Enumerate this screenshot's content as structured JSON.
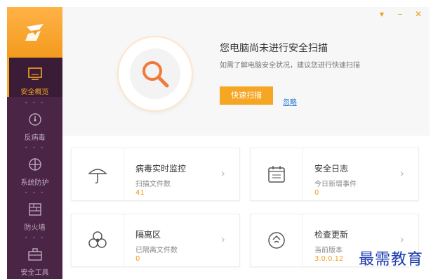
{
  "sidebar": {
    "items": [
      {
        "label": "安全概览",
        "icon": "monitor-icon"
      },
      {
        "label": "反病毒",
        "icon": "gauge-icon"
      },
      {
        "label": "系统防护",
        "icon": "shield-icon"
      },
      {
        "label": "防火墙",
        "icon": "firewall-icon"
      },
      {
        "label": "安全工具",
        "icon": "toolbox-icon"
      }
    ],
    "separator": "• • •"
  },
  "window_controls": {
    "menu": "▾",
    "minimize": "–",
    "close": "✕"
  },
  "hero": {
    "title": "您电脑尚未进行安全扫描",
    "subtitle": "如需了解电脑安全状况，建议您进行快速扫描",
    "scan_button": "快速扫描",
    "ignore_link": "忽略",
    "icon": "search-icon"
  },
  "cards": [
    {
      "title": "病毒实时监控",
      "subtitle": "扫描文件数",
      "value": "41",
      "icon": "umbrella-icon"
    },
    {
      "title": "安全日志",
      "subtitle": "今日新增事件",
      "value": "0",
      "icon": "calendar-icon"
    },
    {
      "title": "隔离区",
      "subtitle": "已隔离文件数",
      "value": "0",
      "icon": "biohazard-icon"
    },
    {
      "title": "检查更新",
      "subtitle": "当前版本",
      "value": "3.0.0.12",
      "icon": "update-icon"
    }
  ],
  "chevron": "›",
  "watermark": "最需教育",
  "colors": {
    "accent": "#f5a623",
    "sidebar": "#4a2545",
    "link": "#2d7bd6"
  }
}
